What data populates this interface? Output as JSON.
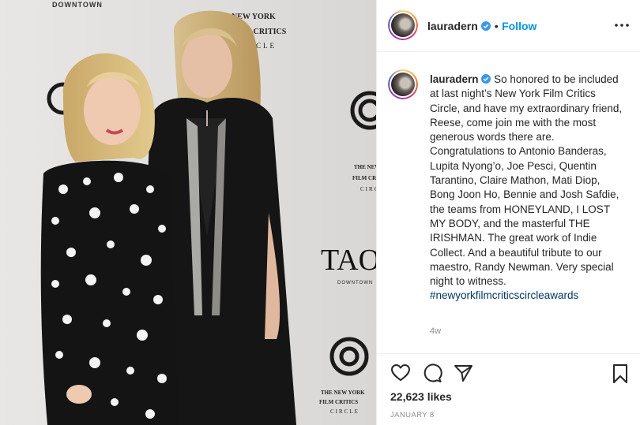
{
  "post": {
    "username": "lauradern",
    "follow_label": "Follow",
    "separator": "•",
    "caption_text": "So honored to be included at last night’s New York Film Critics Circle, and have my extraordinary friend, Reese, come join me with the most generous words there are. Congratulations to Antonio Banderas, Lupita Nyong’o, Joe Pesci, Quentin Tarantino, Claire Mathon, Mati Diop, Bong Joon Ho, Bennie and Josh Safdie, the teams from HONEYLAND, I LOST MY BODY, and the masterful THE IRISHMAN. The great work of Indie Collect. And a beautiful tribute to our maestro, Randy Newman. Very special night to witness.",
    "hashtag": "#newyorkfilmcriticscircleawards",
    "age": "4w",
    "likes": "22,623 likes",
    "date": "JANUARY 8"
  },
  "photo": {
    "backdrop_texts": {
      "downtown_top": "DOWNTOWN",
      "nyfcc_top": [
        "NEW YORK",
        "FILM CRITICS",
        "CIRCLE"
      ],
      "nyfcc_mid": [
        "THE NEW YORK",
        "FILM CRITICS",
        "CIRCLE"
      ],
      "tao": "TAO",
      "tao_sub": "DOWNTOWN",
      "nyfcc_bottom": [
        "THE NEW YORK",
        "FILM CRITICS",
        "CIRCLE"
      ]
    }
  },
  "icons": [
    "verified-badge-icon",
    "more-options-icon",
    "heart-icon",
    "comment-icon",
    "share-icon",
    "bookmark-icon"
  ],
  "colors": {
    "link_blue": "#0095f6",
    "hashtag": "#00376b",
    "verified": "#3897f0",
    "muted": "#8e8e8e"
  }
}
